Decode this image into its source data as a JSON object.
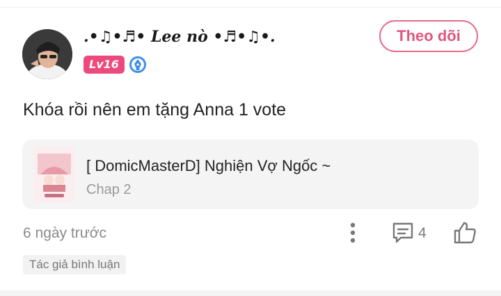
{
  "comment": {
    "user": {
      "name": ".•♫•♬• Lee nò •♬•♫•.",
      "level_badge": "Lv16",
      "avatar_icon": "avatar-photo",
      "verified_icon": "pen-nib-badge-icon"
    },
    "follow_label": "Theo dõi",
    "text": "Khóa rồi nên em tặng Anna 1 vote",
    "story": {
      "title": "[ DomicMasterD] Nghiện Vợ Ngốc ~",
      "chapter": "Chap 2"
    },
    "timestamp": "6 ngày trước",
    "reply_count": "4",
    "author_tag": "Tác giả bình luận",
    "icons": {
      "more": "more-vertical-icon",
      "comment": "comment-bubble-icon",
      "like": "thumbs-up-icon"
    },
    "colors": {
      "accent": "#e0567c",
      "badge": "#ec4a7c",
      "verified": "#3d8fe6",
      "card_bg": "#f4f4f4"
    }
  }
}
